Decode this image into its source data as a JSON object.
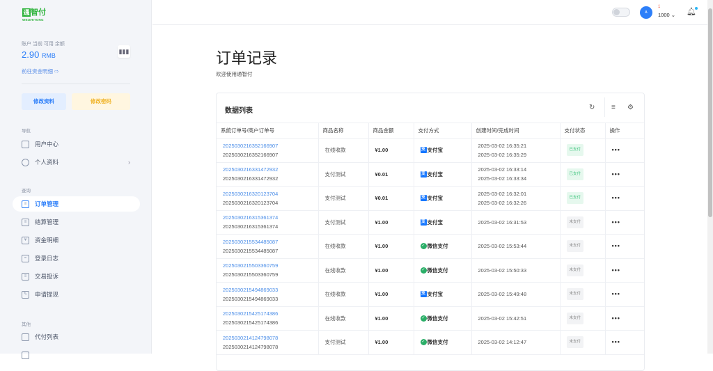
{
  "brand": {
    "cn": "智付",
    "mark": "通",
    "en": "WEIZHITONG"
  },
  "account": {
    "label": "账户 当前 可用 余额",
    "balance": "2.90",
    "currency": "RMB",
    "detail_link": "前往资金明细",
    "edit_profile": "修改资料",
    "change_password": "修改密码"
  },
  "nav": {
    "sections": [
      "导航",
      "查询",
      "其他"
    ],
    "items": [
      {
        "label": "用户中心"
      },
      {
        "label": "个人资料"
      },
      {
        "label": "订单管理"
      },
      {
        "label": "结算管理"
      },
      {
        "label": "资金明细"
      },
      {
        "label": "登录日志"
      },
      {
        "label": "交易投诉"
      },
      {
        "label": "申请提现"
      },
      {
        "label": "代付列表"
      }
    ]
  },
  "header": {
    "notice_count": "1",
    "user": "1000"
  },
  "page": {
    "title": "订单记录",
    "subtitle": "欢迎使用通智付"
  },
  "card": {
    "title": "数据列表"
  },
  "table": {
    "columns": [
      "系统订单号/商户订单号",
      "商品名称",
      "商品金额",
      "支付方式",
      "创建时间/完成时间",
      "支付状态",
      "操作"
    ],
    "rows": [
      {
        "sys": "2025030216352166907",
        "mch": "2025030216352166907",
        "name": "在线收款",
        "amount": "¥1.00",
        "pay": "支付宝",
        "payType": "alipay",
        "created": "2025-03-02 16:35:21",
        "done": "2025-03-02 16:35:29",
        "status": "已支付",
        "paid": true
      },
      {
        "sys": "2025030216331472932",
        "mch": "2025030216331472932",
        "name": "支付测试",
        "amount": "¥0.01",
        "pay": "支付宝",
        "payType": "alipay",
        "created": "2025-03-02 16:33:14",
        "done": "2025-03-02 16:33:34",
        "status": "已支付",
        "paid": true
      },
      {
        "sys": "2025030216320123704",
        "mch": "2025030216320123704",
        "name": "支付测试",
        "amount": "¥0.01",
        "pay": "支付宝",
        "payType": "alipay",
        "created": "2025-03-02 16:32:01",
        "done": "2025-03-02 16:32:26",
        "status": "已支付",
        "paid": true
      },
      {
        "sys": "2025030216315361374",
        "mch": "2025030216315361374",
        "name": "支付测试",
        "amount": "¥1.00",
        "pay": "支付宝",
        "payType": "alipay",
        "created": "2025-03-02 16:31:53",
        "done": "",
        "status": "未支付",
        "paid": false
      },
      {
        "sys": "2025030215534485087",
        "mch": "2025030215534485087",
        "name": "在线收款",
        "amount": "¥1.00",
        "pay": "微信支付",
        "payType": "wechat",
        "created": "2025-03-02 15:53:44",
        "done": "",
        "status": "未支付",
        "paid": false
      },
      {
        "sys": "2025030215503360759",
        "mch": "2025030215503360759",
        "name": "在线收款",
        "amount": "¥1.00",
        "pay": "微信支付",
        "payType": "wechat",
        "created": "2025-03-02 15:50:33",
        "done": "",
        "status": "未支付",
        "paid": false
      },
      {
        "sys": "2025030215494869033",
        "mch": "2025030215494869033",
        "name": "在线收款",
        "amount": "¥1.00",
        "pay": "支付宝",
        "payType": "alipay",
        "created": "2025-03-02 15:49:48",
        "done": "",
        "status": "未支付",
        "paid": false
      },
      {
        "sys": "2025030215425174386",
        "mch": "2025030215425174386",
        "name": "在线收款",
        "amount": "¥1.00",
        "pay": "微信支付",
        "payType": "wechat",
        "created": "2025-03-02 15:42:51",
        "done": "",
        "status": "未支付",
        "paid": false
      },
      {
        "sys": "2025030214124798078",
        "mch": "2025030214124798078",
        "name": "支付测试",
        "amount": "¥1.00",
        "pay": "微信支付",
        "payType": "wechat",
        "created": "2025-03-02 14:12:47",
        "done": "",
        "status": "未支付",
        "paid": false
      }
    ]
  },
  "colors": {
    "accent": "#2d7ff9",
    "brand": "#2db33b",
    "paid": "#3cc47c"
  }
}
